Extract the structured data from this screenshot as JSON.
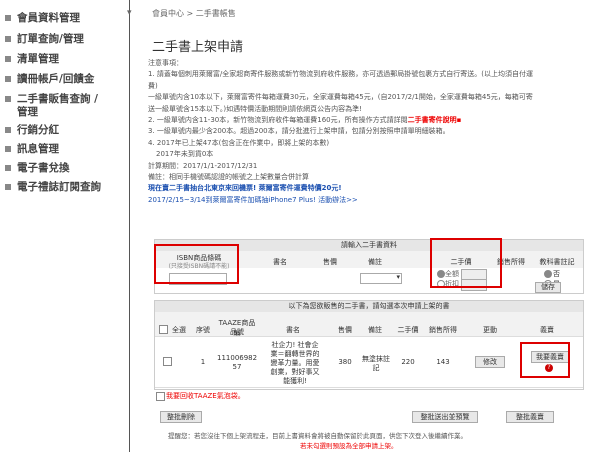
{
  "sidebar": {
    "items": [
      {
        "label": "會員資料管理"
      },
      {
        "label": "訂單查詢/管理"
      },
      {
        "label": "清單管理"
      },
      {
        "label": "讀冊帳戶/回饋金"
      },
      {
        "label": "二手書販售查詢 /"
      },
      {
        "label": "管理"
      },
      {
        "label": "行銷分紅"
      },
      {
        "label": "訊息管理"
      },
      {
        "label": "電子書兌換"
      },
      {
        "label": "電子禮誌訂閱查詢"
      }
    ]
  },
  "breadcrumb": "會員中心 > 二手書帳售",
  "page_title": "二手書上架申請",
  "notes": {
    "l1": "注意事項：",
    "l2": "1. 請蓋每個刺用萊爾富/全家超商寄件服務或新竹物流到府收件服務，亦可透過郵局掛號包裹方式自行寄送。(以上均須自付運",
    "l3": "費)",
    "l4": "一級單號内含10本以下，萊爾富寄件每箱運費30元，全家運費每箱45元，(自2017/2/1開始，全家運費每箱45元，每箱可寄",
    "l5": "送一級單號含15本以下。)如遇特價活動期間則請依網頁公告内容為準!",
    "l6_a": "2. 一級單號内含11-30本，新竹物流到府收件每箱運費160元，所有操作方式請詳閱",
    "l6_link": "二手書寄件說明▪",
    "l7": "3. 一級單號内最少含200本。超過200本，請分批進行上架申請，包請分別按照申請單明細裝箱。",
    "l8": "4. 2017年已上架47本(包含正在作業中，即將上架的本數)",
    "l9": "2017年未到貨0本",
    "l10": "計算期間：2017/1/1-2017/12/31",
    "l11": "備註：相同手機號碼認證的帳號之上架數量合併計算",
    "promo1": "現在賣二手書抽台北東京來回機票! 萊爾富寄件運費特價20元!",
    "promo2": "2017/2/15~3/14到萊爾富寄件加碼抽iPhone7 Plus! 活動辦法>>"
  },
  "input_form": {
    "header": "請輸入二手書資料",
    "col_isbn": "ISBN商品條碼",
    "col_isbn_sub": "(只接受ISBN碼請不能)",
    "col_title": "書名",
    "col_price": "售價",
    "col_remark": "備註",
    "col_condition": "二手價",
    "col_income": "銷售所得",
    "col_textbook": "教科書註記",
    "radio_full": "全額",
    "radio_discount": "折扣",
    "radio_no": "否",
    "radio_yes": "是",
    "save_button": "儲存",
    "isbn_value": ""
  },
  "list_table": {
    "header": "以下為您欲販售的二手書，請勾選本次申請上架的書",
    "headers": {
      "select_all": "全選",
      "seq": "序號",
      "taaze_no": "TAAZE商品編",
      "title": "書名",
      "price": "售價",
      "remark": "備註",
      "used_price": "二手價",
      "income": "銷售所得",
      "edit": "更動",
      "fee": "義賣"
    },
    "rows": [
      {
        "seq": "1",
        "taaze_no_a": "111006982",
        "taaze_no_b": "57",
        "title_a": "社企力! 社會企",
        "title_b": "業＝翻轉世界的",
        "title_c": "變革力量。用愛",
        "title_d": "創業，對好事又",
        "title_e": "能獲利!",
        "price": "380",
        "remark_a": "無塗抹註",
        "remark_b": "記",
        "used_price": "220",
        "income": "143",
        "edit_button": "修改",
        "fee_button": "我要義賣",
        "help": "?"
      }
    ],
    "recycle_bag": "我要回收TAAZE氣泡袋。"
  },
  "actions": {
    "batch_delete": "整批刪除",
    "batch_submit": "整批送出並預覽",
    "batch_fee": "整批義賣"
  },
  "footer": {
    "note": "提醒您：若您沒往下個上架流程走，目前上書資料會將被自動保留於此頁面，供您下次登入後繼續作業。",
    "warning": "若未勾選則預設為全部申請上架。"
  }
}
